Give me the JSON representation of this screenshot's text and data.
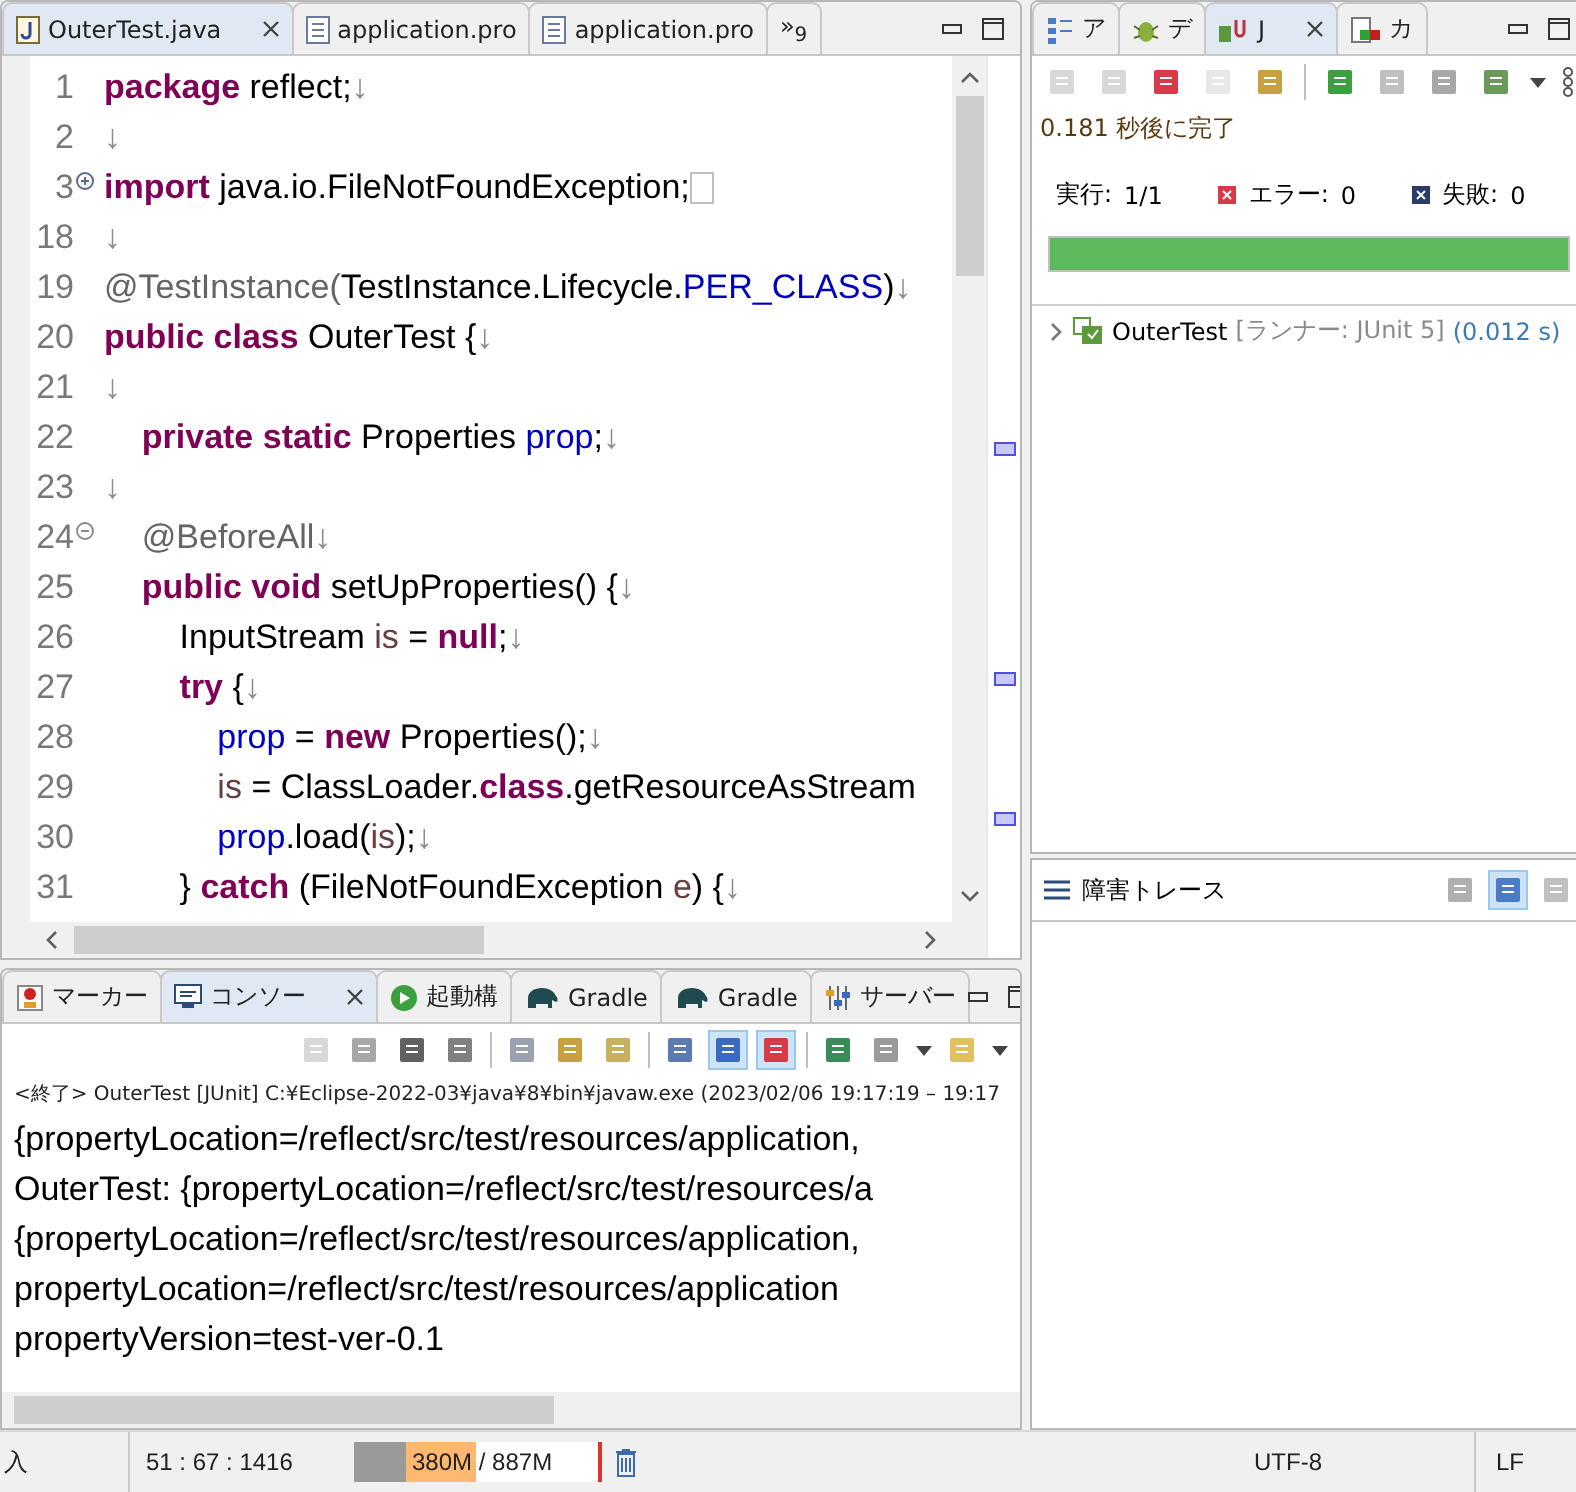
{
  "editor": {
    "tabs": [
      {
        "label": "OuterTest.java",
        "kind": "java",
        "selected": true
      },
      {
        "label": "application.pro",
        "kind": "text",
        "selected": false
      },
      {
        "label": "application.pro",
        "kind": "text",
        "selected": false
      }
    ],
    "overflow": {
      "symbol": "»",
      "count": "9"
    },
    "lines": [
      {
        "number": "1",
        "tokens": [
          {
            "kind": "kw",
            "text": "package"
          },
          {
            "kind": "plain",
            "text": " reflect;"
          },
          {
            "kind": "ws",
            "text": "↓"
          }
        ]
      },
      {
        "number": "2",
        "tokens": [
          {
            "kind": "ws",
            "text": "↓"
          }
        ]
      },
      {
        "number": "3",
        "expanded": false,
        "tokens": [
          {
            "kind": "kw",
            "text": "import"
          },
          {
            "kind": "plain",
            "text": " java.io.FileNotFoundException;"
          }
        ]
      },
      {
        "number": "18",
        "tokens": [
          {
            "kind": "ws",
            "text": "↓"
          }
        ]
      },
      {
        "number": "19",
        "tokens": [
          {
            "kind": "ann",
            "text": "@TestInstance("
          },
          {
            "kind": "plain",
            "text": "TestInstance.Lifecycle."
          },
          {
            "kind": "field",
            "text": "PER_CLASS"
          },
          {
            "kind": "plain",
            "text": ")"
          },
          {
            "kind": "ws",
            "text": "↓"
          }
        ]
      },
      {
        "number": "20",
        "tokens": [
          {
            "kind": "kw",
            "text": "public class"
          },
          {
            "kind": "plain",
            "text": " OuterTest {"
          },
          {
            "kind": "ws",
            "text": "↓"
          }
        ]
      },
      {
        "number": "21",
        "tokens": [
          {
            "kind": "ws",
            "text": "↓"
          }
        ]
      },
      {
        "number": "22",
        "tokens": [
          {
            "kind": "kw",
            "text": "    private static"
          },
          {
            "kind": "plain",
            "text": " Properties "
          },
          {
            "kind": "field",
            "text": "prop"
          },
          {
            "kind": "plain",
            "text": ";"
          },
          {
            "kind": "ws",
            "text": "↓"
          }
        ]
      },
      {
        "number": "23",
        "tokens": [
          {
            "kind": "ws",
            "text": "↓"
          }
        ]
      },
      {
        "number": "24",
        "expanded": true,
        "tokens": [
          {
            "kind": "ann",
            "text": "    @BeforeAll"
          },
          {
            "kind": "ws",
            "text": "↓"
          }
        ]
      },
      {
        "number": "25",
        "tokens": [
          {
            "kind": "kw",
            "text": "    public void"
          },
          {
            "kind": "plain",
            "text": " setUpProperties() {"
          },
          {
            "kind": "ws",
            "text": "↓"
          }
        ]
      },
      {
        "number": "26",
        "tokens": [
          {
            "kind": "plain",
            "text": "        InputStream "
          },
          {
            "kind": "local",
            "text": "is"
          },
          {
            "kind": "plain",
            "text": " = "
          },
          {
            "kind": "kw",
            "text": "null"
          },
          {
            "kind": "plain",
            "text": ";"
          },
          {
            "kind": "ws",
            "text": "↓"
          }
        ]
      },
      {
        "number": "27",
        "tokens": [
          {
            "kind": "kw",
            "text": "        try"
          },
          {
            "kind": "plain",
            "text": " {"
          },
          {
            "kind": "ws",
            "text": "↓"
          }
        ]
      },
      {
        "number": "28",
        "tokens": [
          {
            "kind": "field",
            "text": "            prop"
          },
          {
            "kind": "plain",
            "text": " = "
          },
          {
            "kind": "kw",
            "text": "new"
          },
          {
            "kind": "plain",
            "text": " Properties();"
          },
          {
            "kind": "ws",
            "text": "↓"
          }
        ]
      },
      {
        "number": "29",
        "tokens": [
          {
            "kind": "local",
            "text": "            is"
          },
          {
            "kind": "plain",
            "text": " = ClassLoader."
          },
          {
            "kind": "kw",
            "text": "class"
          },
          {
            "kind": "plain",
            "text": ".getResourceAsStream"
          }
        ]
      },
      {
        "number": "30",
        "tokens": [
          {
            "kind": "field",
            "text": "            prop"
          },
          {
            "kind": "plain",
            "text": ".load("
          },
          {
            "kind": "local",
            "text": "is"
          },
          {
            "kind": "plain",
            "text": ");"
          },
          {
            "kind": "ws",
            "text": "↓"
          }
        ]
      },
      {
        "number": "31",
        "tokens": [
          {
            "kind": "plain",
            "text": "        } "
          },
          {
            "kind": "kw",
            "text": "catch"
          },
          {
            "kind": "plain",
            "text": " (FileNotFoundException "
          },
          {
            "kind": "local",
            "text": "e"
          },
          {
            "kind": "plain",
            "text": ") {"
          },
          {
            "kind": "ws",
            "text": "↓"
          }
        ]
      }
    ]
  },
  "junit": {
    "tabs": [
      {
        "label": "ア",
        "kind": "outline",
        "selected": false
      },
      {
        "label": "デ",
        "kind": "debug",
        "selected": false
      },
      {
        "label": "J",
        "kind": "junit",
        "selected": true
      },
      {
        "label": "カ",
        "kind": "coverage",
        "selected": false
      }
    ],
    "status": "0.181 秒後に完了",
    "counters": [
      {
        "kind": "runs",
        "label": "実行:",
        "value": "1/1"
      },
      {
        "kind": "errors",
        "label": "エラー:",
        "value": "0"
      },
      {
        "kind": "failures",
        "label": "失敗:",
        "value": "0"
      }
    ],
    "progress": {
      "level": 1
    },
    "tree": [
      {
        "name": "OuterTest",
        "runner": "[ランナー: JUnit 5]",
        "time": "(0.012 s)",
        "expanded": false
      }
    ]
  },
  "failure_trace": {
    "title": "障害トレース"
  },
  "console": {
    "tabs": [
      {
        "label": "マーカー",
        "kind": "markers",
        "selected": false
      },
      {
        "label": "コンソー",
        "kind": "console",
        "selected": true
      },
      {
        "label": "起動構",
        "kind": "launch",
        "selected": false
      },
      {
        "label": "Gradle",
        "kind": "gradle",
        "selected": false
      },
      {
        "label": "Gradle",
        "kind": "gradle",
        "selected": false
      },
      {
        "label": "サーバー",
        "kind": "servers",
        "selected": false
      }
    ],
    "header": "<終了> OuterTest [JUnit] C:¥Eclipse-2022-03¥java¥8¥bin¥javaw.exe  (2023/02/06 19:17:19 – 19:17",
    "lines": [
      "{propertyLocation=/reflect/src/test/resources/application,",
      "OuterTest: {propertyLocation=/reflect/src/test/resources/a",
      "{propertyLocation=/reflect/src/test/resources/application,",
      "propertyLocation=/reflect/src/test/resources/application",
      "propertyVersion=test-ver-0.1"
    ]
  },
  "status_bar": {
    "mode": "入",
    "position": "51 : 67 : 1416",
    "heap": {
      "used": "380M",
      "total": "/ 887M",
      "level": 0.5
    },
    "encoding": "UTF-8",
    "line_delimiter": "LF"
  }
}
